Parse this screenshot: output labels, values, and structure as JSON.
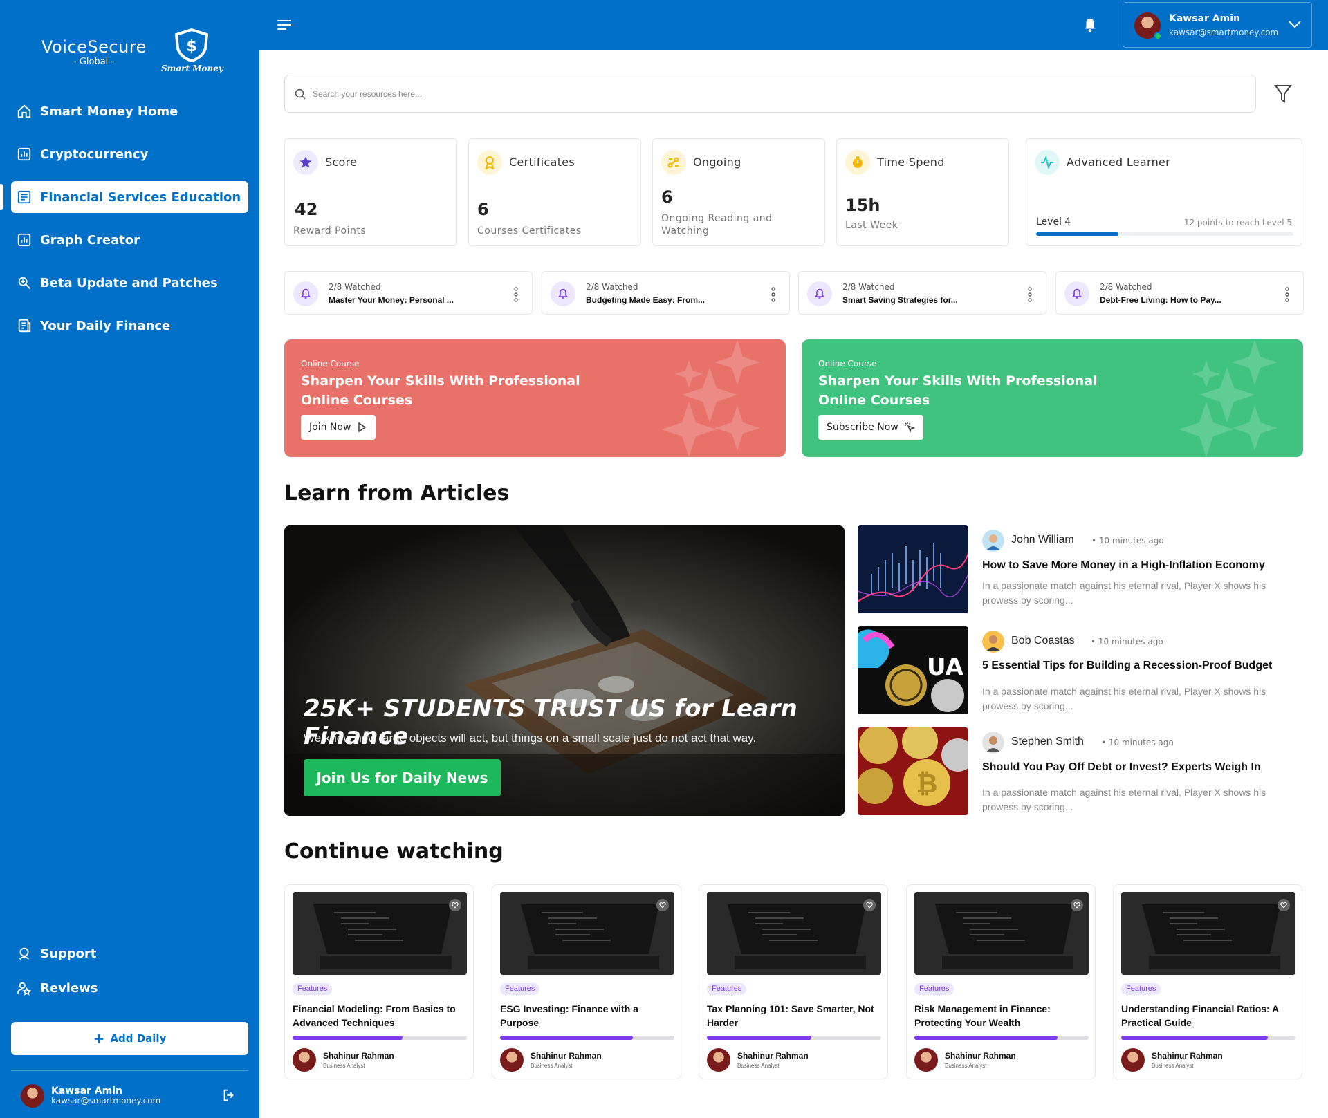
{
  "brand": {
    "name": "VoiceSecure",
    "sub": "- Global -",
    "tag": "Smart Money"
  },
  "sidebar": {
    "items": [
      {
        "label": "Smart Money Home",
        "icon": "home-icon"
      },
      {
        "label": "Cryptocurrency",
        "icon": "chart-icon"
      },
      {
        "label": "Financial Services Education",
        "icon": "document-icon",
        "active": true
      },
      {
        "label": "Graph Creator",
        "icon": "chart-icon"
      },
      {
        "label": "Beta Update and Patches",
        "icon": "patch-icon"
      },
      {
        "label": "Your Daily Finance",
        "icon": "finance-icon"
      }
    ],
    "bottom_items": [
      {
        "label": "Support",
        "icon": "support-icon"
      },
      {
        "label": "Reviews",
        "icon": "reviews-icon"
      }
    ],
    "add_label": "Add Daily",
    "user": {
      "name": "Kawsar Amin",
      "email": "kawsar@smartmoney.com"
    }
  },
  "header": {
    "user": {
      "name": "Kawsar Amin",
      "email": "kawsar@smartmoney.com"
    }
  },
  "search": {
    "placeholder": "Search your resources here..."
  },
  "stats": [
    {
      "title": "Score",
      "value": "42",
      "sub": "Reward Points",
      "icon": "star-icon",
      "color": "#5b3ec8"
    },
    {
      "title": "Certificates",
      "value": "6",
      "sub": "Courses Certificates",
      "icon": "award-icon",
      "color": "#f5b800"
    },
    {
      "title": "Ongoing",
      "value": "6",
      "sub": "Ongoing Reading and Watching",
      "icon": "ongoing-icon",
      "color": "#f5b800"
    },
    {
      "title": "Time Spend",
      "value": "15h",
      "sub": "Last Week",
      "icon": "timer-icon",
      "color": "#f5b800"
    },
    {
      "title": "Advanced Learner",
      "level": "Level 4",
      "note": "12 points to reach Level 5",
      "progress": 0.32,
      "icon": "pulse-icon",
      "color": "#22c1c3"
    }
  ],
  "watched": [
    {
      "meta": "2/8 Watched",
      "title": "Master Your Money: Personal ..."
    },
    {
      "meta": "2/8 Watched",
      "title": "Budgeting Made Easy: From..."
    },
    {
      "meta": "2/8 Watched",
      "title": "Smart Saving Strategies for..."
    },
    {
      "meta": "2/8 Watched",
      "title": "Debt-Free Living: How to Pay..."
    }
  ],
  "promos": [
    {
      "kicker": "Online Course",
      "title": "Sharpen  Your Skills With Professional Online Courses",
      "button": "Join Now",
      "color": "#e8716a"
    },
    {
      "kicker": "Online Course",
      "title": "Sharpen  Your Skills With Professional Online Courses",
      "button": "Subscribe Now",
      "color": "#3fc37e"
    }
  ],
  "articles_section": {
    "title": "Learn from Articles"
  },
  "hero": {
    "title": "25K+ STUDENTS TRUST US for Learn Finance",
    "subtitle": "We know how large objects will act, but things on a small scale just do not act that way.",
    "button": "Join Us for Daily News"
  },
  "articles": [
    {
      "author": "John William",
      "time": "• 10 minutes ago",
      "title": "How to Save More Money in a High-Inflation Economy",
      "desc": "In a passionate match against his eternal rival, Player X shows his prowess by scoring..."
    },
    {
      "author": "Bob Coastas",
      "time": "• 10 minutes ago",
      "title": "5 Essential Tips for Building a Recession-Proof Budget",
      "desc": "In a passionate match against his eternal rival, Player X shows his prowess by scoring..."
    },
    {
      "author": "Stephen Smith",
      "time": "• 10 minutes ago",
      "title": "Should You Pay Off Debt or Invest? Experts Weigh In",
      "desc": "In a passionate match against his eternal rival, Player X shows his prowess by scoring..."
    }
  ],
  "continue_section": {
    "title": "Continue watching"
  },
  "courses": [
    {
      "badge": "Features",
      "title": "Financial Modeling: From Basics to Advanced Techniques",
      "progress": 0.63,
      "author": "Shahinur Rahman",
      "role": "Business Analyst"
    },
    {
      "badge": "Features",
      "title": "ESG Investing: Finance with a Purpose",
      "progress": 0.76,
      "author": "Shahinur Rahman",
      "role": "Business Analyst"
    },
    {
      "badge": "Features",
      "title": "Tax Planning 101: Save Smarter, Not Harder",
      "progress": 0.6,
      "author": "Shahinur Rahman",
      "role": "Business Analyst"
    },
    {
      "badge": "Features",
      "title": "Risk Management in Finance: Protecting Your Wealth",
      "progress": 0.82,
      "author": "Shahinur Rahman",
      "role": "Business Analyst"
    },
    {
      "badge": "Features",
      "title": "Understanding Financial Ratios: A Practical Guide",
      "progress": 0.84,
      "author": "Shahinur Rahman",
      "role": "Business Analyst"
    }
  ]
}
